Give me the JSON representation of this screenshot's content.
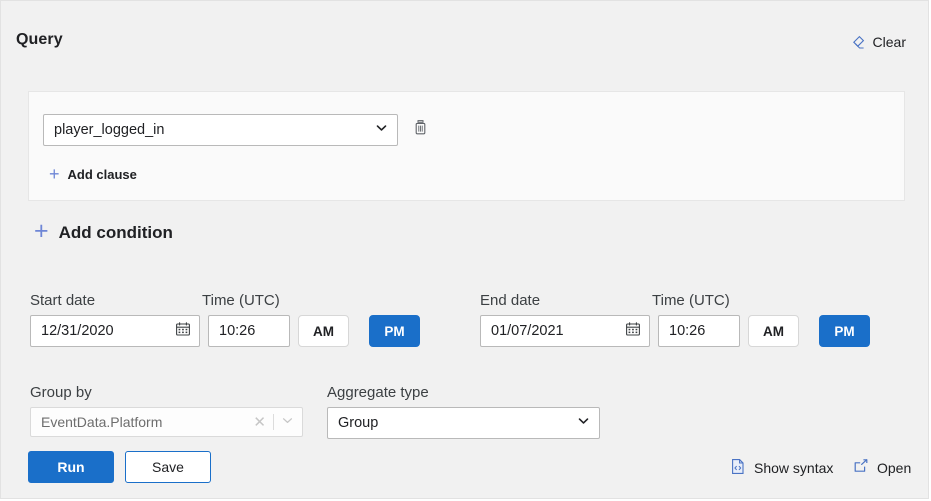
{
  "header": {
    "title": "Query",
    "clear_label": "Clear",
    "clear_icon": "eraser-icon"
  },
  "clause": {
    "event_value": "player_logged_in",
    "dropdown_icon": "chevron-down-icon",
    "delete_icon": "trash-icon",
    "add_clause_label": "Add clause",
    "add_clause_icon": "plus-icon"
  },
  "add_condition": {
    "label": "Add condition",
    "icon": "plus-icon"
  },
  "start": {
    "date_label": "Start date",
    "date_value": "12/31/2020",
    "calendar_icon": "calendar-icon",
    "time_label": "Time (UTC)",
    "time_value": "10:26",
    "am_label": "AM",
    "pm_label": "PM",
    "meridiem_selected": "PM"
  },
  "end": {
    "date_label": "End date",
    "date_value": "01/07/2021",
    "calendar_icon": "calendar-icon",
    "time_label": "Time (UTC)",
    "time_value": "10:26",
    "am_label": "AM",
    "pm_label": "PM",
    "meridiem_selected": "PM"
  },
  "group_by": {
    "label": "Group by",
    "value": "EventData.Platform",
    "clear_icon": "close-icon",
    "dropdown_icon": "chevron-down-icon"
  },
  "aggregate": {
    "label": "Aggregate type",
    "value": "Group",
    "dropdown_icon": "chevron-down-icon"
  },
  "footer": {
    "run_label": "Run",
    "save_label": "Save",
    "show_syntax_label": "Show syntax",
    "show_syntax_icon": "code-file-icon",
    "open_label": "Open",
    "open_icon": "external-link-icon"
  },
  "colors": {
    "accent_blue": "#1a6fc9",
    "icon_blue": "#4a73c4",
    "plus_blue": "#6e86d6",
    "page_bg": "#f1f1f1",
    "card_bg": "#fafafa",
    "text": "#202124"
  }
}
